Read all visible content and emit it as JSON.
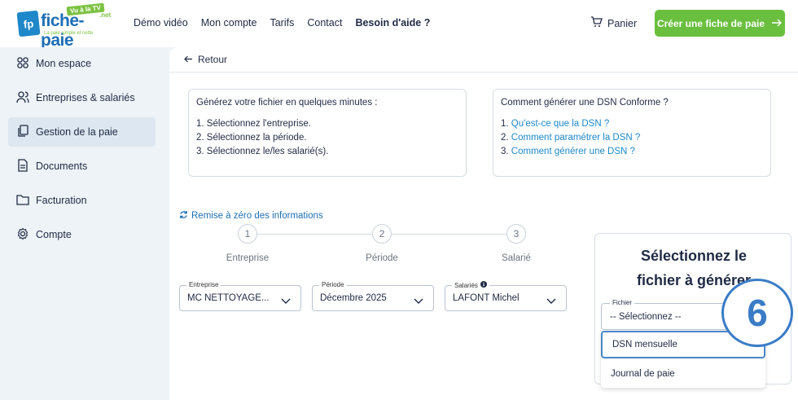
{
  "logo": {
    "name": "fiche-paie",
    "tv": "Vu à la TV",
    "net": ".net",
    "tagline": "La paie simple et nette",
    "badge": "fp"
  },
  "nav": {
    "items": [
      "Démo vidéo",
      "Mon compte",
      "Tarifs",
      "Contact",
      "Besoin d'aide ?"
    ],
    "cart": "Panier",
    "cta": "Créer une fiche de paie"
  },
  "sidebar": {
    "items": [
      {
        "label": "Mon espace",
        "icon": "grid-icon"
      },
      {
        "label": "Entreprises & salariés",
        "icon": "users-icon"
      },
      {
        "label": "Gestion de la paie",
        "icon": "copy-icon",
        "active": true
      },
      {
        "label": "Documents",
        "icon": "document-icon"
      },
      {
        "label": "Facturation",
        "icon": "folder-icon"
      },
      {
        "label": "Compte",
        "icon": "gear-icon"
      }
    ]
  },
  "main": {
    "back": "Retour",
    "card_left": {
      "head": "Générez votre fichier en quelques minutes :",
      "steps": [
        "1. Sélectionnez l'entreprise.",
        "2. Sélectionnez la période.",
        "3. Sélectionnez le/les salarié(s)."
      ]
    },
    "card_right": {
      "head": "Comment générer une DSN Conforme ?",
      "num": [
        "1.",
        "2.",
        "3."
      ],
      "links": [
        "Qu'est-ce que la DSN ?",
        "Comment paramétrer la DSN ?",
        "Comment générer une DSN ?"
      ]
    },
    "reset": "Remise à zéro des informations",
    "steps": [
      {
        "num": "1",
        "label": "Entreprise"
      },
      {
        "num": "2",
        "label": "Période"
      },
      {
        "num": "3",
        "label": "Salarié"
      }
    ],
    "fields": {
      "entreprise": {
        "label": "Entreprise",
        "value": "MC NETTOYAGE..."
      },
      "periode": {
        "label": "Période",
        "value": "Décembre 2025"
      },
      "salaries": {
        "label": "Salariés",
        "value": "LAFONT Michel"
      }
    },
    "panel": {
      "title_line1": "Sélectionnez le",
      "title_line2": "fichier à générer",
      "field_label": "Fichier",
      "field_value": "-- Sélectionnez --",
      "options": [
        "DSN mensuelle",
        "Journal de paie"
      ]
    },
    "step_badge": "6"
  },
  "colors": {
    "accent": "#1e88c8",
    "cta": "#6abf3f",
    "badge": "#3a7cc6",
    "sidebar_bg": "#eef3f7"
  }
}
